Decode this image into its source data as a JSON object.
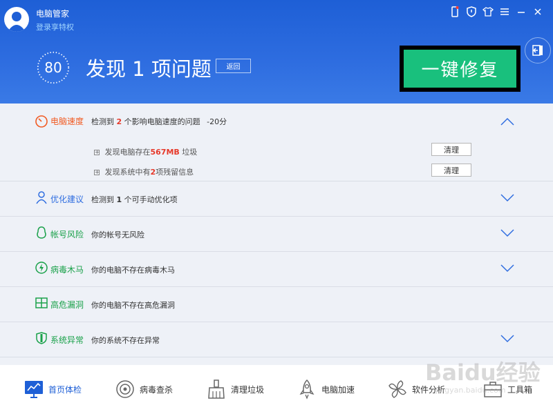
{
  "header": {
    "user_name": "电脑管家",
    "user_link": "登录享特权",
    "score": "80",
    "title": "发现 1 项问题",
    "back_label": "返回",
    "fix_label": "一键修复"
  },
  "categories": {
    "speed": {
      "label": "电脑速度",
      "desc_pre": "检测到",
      "desc_num": "2",
      "desc_post": "个影响电脑速度的问题",
      "desc_score": "-20分",
      "items": [
        {
          "pre": "发现电脑存在",
          "value": "567MB",
          "post": "垃圾",
          "button": "清理"
        },
        {
          "pre": "发现系统中有",
          "value": "2",
          "post": "项残留信息",
          "button": "清理"
        }
      ]
    },
    "optimize": {
      "label": "优化建议",
      "desc_pre": "检测到",
      "desc_num": "1",
      "desc_post": "个可手动优化项"
    },
    "account": {
      "label": "帐号风险",
      "desc": "你的帐号无风险"
    },
    "virus": {
      "label": "病毒木马",
      "desc": "你的电脑不存在病毒木马"
    },
    "vuln": {
      "label": "高危漏洞",
      "desc": "你的电脑不存在高危漏洞"
    },
    "system": {
      "label": "系统异常",
      "desc": "你的系统不存在异常"
    }
  },
  "nav": [
    "首页体检",
    "病毒查杀",
    "清理垃圾",
    "电脑加速",
    "软件分析",
    "工具箱"
  ],
  "watermark": {
    "text": "Baidu经验",
    "sub": "jingyan.baidu.com"
  },
  "colors": {
    "header_blue": "#1e5fd6",
    "fix_green": "#19c07d",
    "warn_orange": "#f15a22",
    "ok_green": "#1aa14a"
  }
}
